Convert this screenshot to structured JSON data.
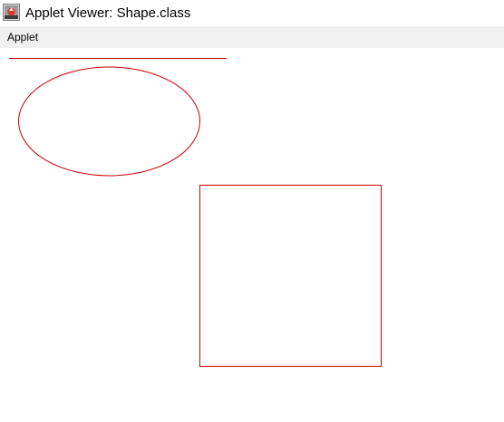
{
  "window": {
    "title": "Applet Viewer: Shape.class",
    "icon": "java-applet-icon"
  },
  "menubar": {
    "items": [
      {
        "label": "Applet"
      }
    ]
  },
  "applet": {
    "stroke_color": "#cc0000",
    "shapes": [
      "line",
      "oval",
      "rectangle"
    ]
  }
}
